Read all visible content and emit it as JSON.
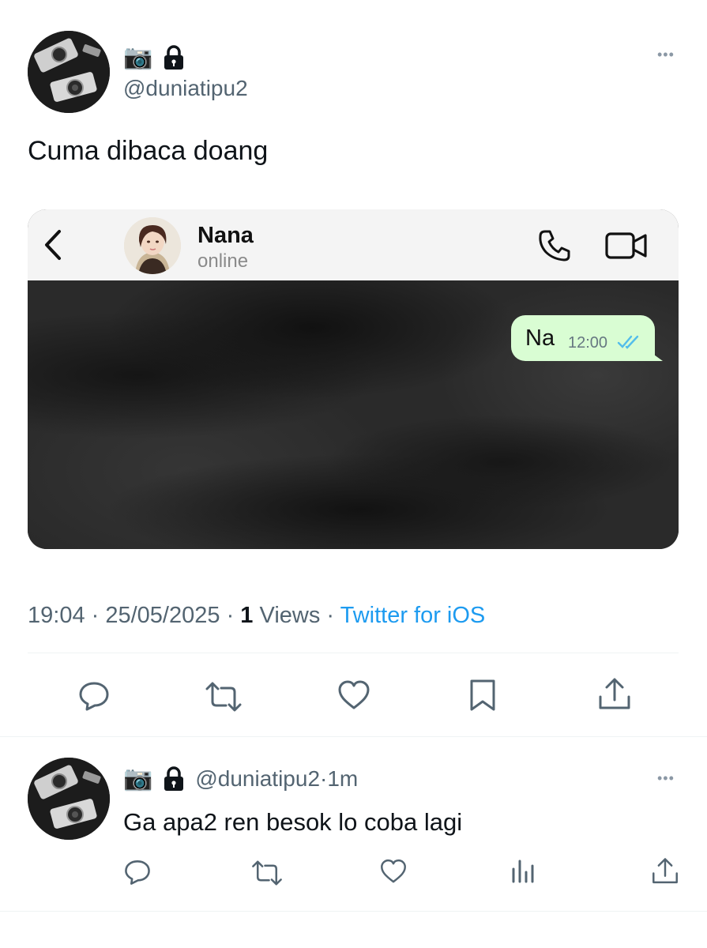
{
  "tweet": {
    "display_name_emoji": "📷",
    "handle": "@duniatipu2",
    "text": "Cuma dibaca doang",
    "more_label": "•••",
    "meta": {
      "time": "19:04",
      "sep1": " · ",
      "date": "25/05/2025",
      "sep2": " · ",
      "views_count": "1",
      "views_label": " Views",
      "sep3": " · ",
      "source": "Twitter for iOS"
    }
  },
  "chat": {
    "contact_name": "Nana",
    "status": "online",
    "message_text": "Na",
    "message_time": "12:00"
  },
  "reply": {
    "display_name_emoji": "📷",
    "handle": "@duniatipu2",
    "dot": " · ",
    "age": "1m",
    "text": "Ga apa2 ren besok lo coba lagi",
    "more_label": "•••"
  },
  "colors": {
    "link": "#1d9bf0",
    "muted": "#536471",
    "bubble": "#d9fdd3",
    "tick_blue": "#53bdeb"
  },
  "icons": {
    "tweet_actions": [
      "reply-icon",
      "retweet-icon",
      "like-icon",
      "bookmark-icon",
      "share-icon"
    ],
    "reply_actions": [
      "reply-icon",
      "retweet-icon",
      "like-icon",
      "views-icon",
      "share-icon"
    ]
  }
}
